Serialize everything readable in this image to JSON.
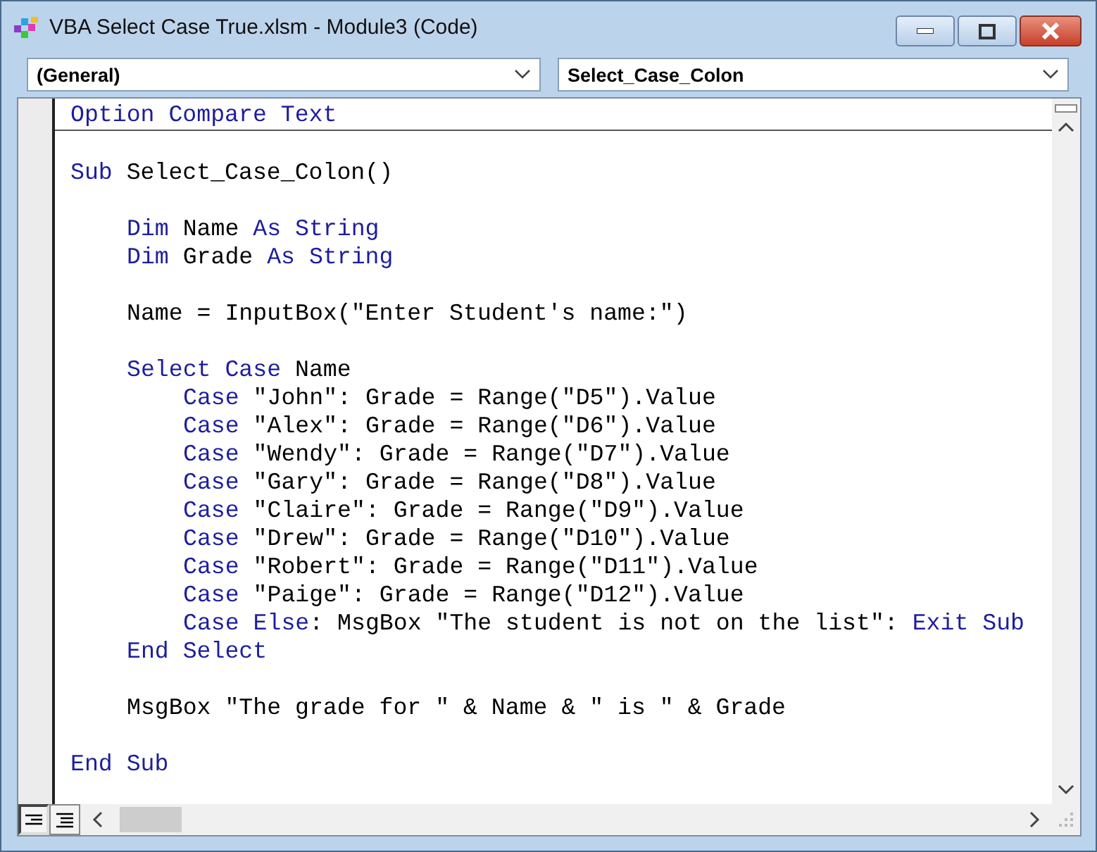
{
  "window": {
    "title": "VBA Select Case True.xlsm - Module3 (Code)"
  },
  "object_box": {
    "value": "(General)"
  },
  "procedure_box": {
    "value": "Select_Case_Colon"
  },
  "code": {
    "sections": [
      {
        "lines": [
          {
            "kind": "code",
            "segments": [
              {
                "kind": "keyword",
                "text": "Option Compare Text"
              }
            ]
          }
        ]
      },
      {
        "lines": [
          {
            "kind": "blank"
          },
          {
            "kind": "code",
            "segments": [
              {
                "kind": "keyword",
                "text": "Sub"
              },
              {
                "kind": "plain",
                "text": " Select_Case_Colon()"
              }
            ],
            "children": [
              {
                "kind": "blank"
              },
              {
                "kind": "code",
                "segments": [
                  {
                    "kind": "keyword",
                    "text": "Dim"
                  },
                  {
                    "kind": "plain",
                    "text": " Name "
                  },
                  {
                    "kind": "keyword",
                    "text": "As String"
                  }
                ]
              },
              {
                "kind": "code",
                "segments": [
                  {
                    "kind": "keyword",
                    "text": "Dim"
                  },
                  {
                    "kind": "plain",
                    "text": " Grade "
                  },
                  {
                    "kind": "keyword",
                    "text": "As String"
                  }
                ]
              },
              {
                "kind": "blank"
              },
              {
                "kind": "code",
                "segments": [
                  {
                    "kind": "plain",
                    "text": "Name = InputBox(\"Enter Student's name:\")"
                  }
                ]
              },
              {
                "kind": "blank"
              },
              {
                "kind": "code",
                "segments": [
                  {
                    "kind": "keyword",
                    "text": "Select Case"
                  },
                  {
                    "kind": "plain",
                    "text": " Name"
                  }
                ],
                "children": [
                  {
                    "kind": "code",
                    "segments": [
                      {
                        "kind": "keyword",
                        "text": "Case"
                      },
                      {
                        "kind": "plain",
                        "text": " \"John\": Grade = Range(\"D5\").Value"
                      }
                    ]
                  },
                  {
                    "kind": "code",
                    "segments": [
                      {
                        "kind": "keyword",
                        "text": "Case"
                      },
                      {
                        "kind": "plain",
                        "text": " \"Alex\": Grade = Range(\"D6\").Value"
                      }
                    ]
                  },
                  {
                    "kind": "code",
                    "segments": [
                      {
                        "kind": "keyword",
                        "text": "Case"
                      },
                      {
                        "kind": "plain",
                        "text": " \"Wendy\": Grade = Range(\"D7\").Value"
                      }
                    ]
                  },
                  {
                    "kind": "code",
                    "segments": [
                      {
                        "kind": "keyword",
                        "text": "Case"
                      },
                      {
                        "kind": "plain",
                        "text": " \"Gary\": Grade = Range(\"D8\").Value"
                      }
                    ]
                  },
                  {
                    "kind": "code",
                    "segments": [
                      {
                        "kind": "keyword",
                        "text": "Case"
                      },
                      {
                        "kind": "plain",
                        "text": " \"Claire\": Grade = Range(\"D9\").Value"
                      }
                    ]
                  },
                  {
                    "kind": "code",
                    "segments": [
                      {
                        "kind": "keyword",
                        "text": "Case"
                      },
                      {
                        "kind": "plain",
                        "text": " \"Drew\": Grade = Range(\"D10\").Value"
                      }
                    ]
                  },
                  {
                    "kind": "code",
                    "segments": [
                      {
                        "kind": "keyword",
                        "text": "Case"
                      },
                      {
                        "kind": "plain",
                        "text": " \"Robert\": Grade = Range(\"D11\").Value"
                      }
                    ]
                  },
                  {
                    "kind": "code",
                    "segments": [
                      {
                        "kind": "keyword",
                        "text": "Case"
                      },
                      {
                        "kind": "plain",
                        "text": " \"Paige\": Grade = Range(\"D12\").Value"
                      }
                    ]
                  },
                  {
                    "kind": "code",
                    "segments": [
                      {
                        "kind": "keyword",
                        "text": "Case Else"
                      },
                      {
                        "kind": "plain",
                        "text": ": MsgBox \"The student is not on the list\": "
                      },
                      {
                        "kind": "keyword",
                        "text": "Exit Sub"
                      }
                    ]
                  }
                ]
              },
              {
                "kind": "code",
                "segments": [
                  {
                    "kind": "keyword",
                    "text": "End Select"
                  }
                ]
              },
              {
                "kind": "blank"
              },
              {
                "kind": "code",
                "segments": [
                  {
                    "kind": "plain",
                    "text": "MsgBox \"The grade for \" & Name & \" is \" & Grade"
                  }
                ]
              },
              {
                "kind": "blank"
              }
            ]
          },
          {
            "kind": "code",
            "segments": [
              {
                "kind": "keyword",
                "text": "End Sub"
              }
            ]
          }
        ]
      }
    ]
  }
}
